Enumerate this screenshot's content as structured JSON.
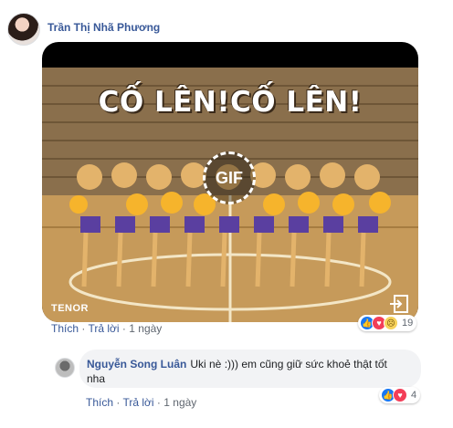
{
  "post": {
    "author": "Trần Thị Nhã Phương",
    "gif": {
      "caption": "CỐ LÊN!CỐ LÊN!",
      "badge": "GIF",
      "provider": "TENOR"
    },
    "actions": {
      "like": "Thích",
      "reply": "Trả lời",
      "time": "1 ngày"
    },
    "reactions": {
      "types": [
        "like",
        "love",
        "sad"
      ],
      "count": "19"
    }
  },
  "reply": {
    "author": "Nguyễn Song Luân",
    "text": "Uki nè :))) em cũng giữ sức khoẻ thật tốt nha",
    "actions": {
      "like": "Thích",
      "reply": "Trả lời",
      "time": "1 ngày"
    },
    "reactions": {
      "types": [
        "like",
        "love"
      ],
      "count": "4"
    }
  },
  "colors": {
    "link": "#385898",
    "meta": "#606770",
    "bubble": "#f2f3f5"
  }
}
